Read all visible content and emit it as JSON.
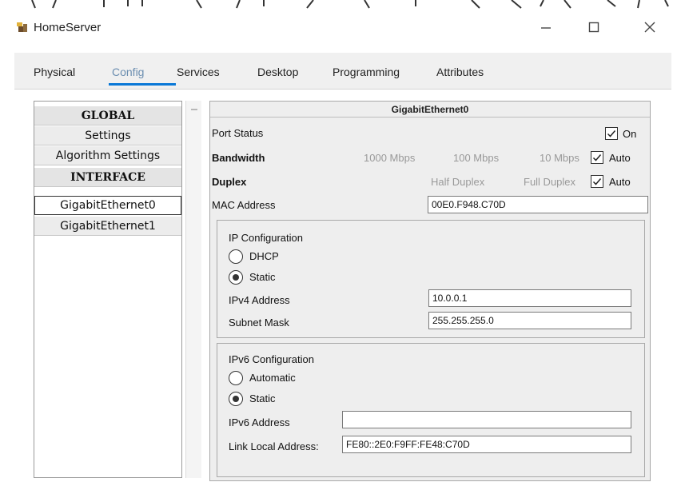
{
  "window": {
    "title": "HomeServer"
  },
  "tabs": [
    {
      "label": "Physical"
    },
    {
      "label": "Config"
    },
    {
      "label": "Services"
    },
    {
      "label": "Desktop"
    },
    {
      "label": "Programming"
    },
    {
      "label": "Attributes"
    }
  ],
  "active_tab": "Config",
  "sidebar": {
    "items": [
      {
        "label": "GLOBAL",
        "kind": "header"
      },
      {
        "label": "Settings",
        "kind": "item"
      },
      {
        "label": "Algorithm Settings",
        "kind": "item"
      },
      {
        "label": "INTERFACE",
        "kind": "header"
      },
      {
        "label": "GigabitEthernet0",
        "kind": "item",
        "selected": true
      },
      {
        "label": "GigabitEthernet1",
        "kind": "item"
      }
    ]
  },
  "interface": {
    "title": "GigabitEthernet0",
    "port_status": {
      "label": "Port Status",
      "on_label": "On",
      "checked": true
    },
    "bandwidth": {
      "label": "Bandwidth",
      "opt1": "1000 Mbps",
      "opt2": "100 Mbps",
      "opt3": "10 Mbps",
      "auto_label": "Auto",
      "auto_checked": true
    },
    "duplex": {
      "label": "Duplex",
      "opt1": "Half Duplex",
      "opt2": "Full Duplex",
      "auto_label": "Auto",
      "auto_checked": true
    },
    "mac": {
      "label": "MAC Address",
      "value": "00E0.F948.C70D"
    },
    "ipv4": {
      "title": "IP Configuration",
      "dhcp_label": "DHCP",
      "static_label": "Static",
      "mode": "static",
      "address_label": "IPv4 Address",
      "address_value": "10.0.0.1",
      "mask_label": "Subnet Mask",
      "mask_value": "255.255.255.0"
    },
    "ipv6": {
      "title": "IPv6 Configuration",
      "auto_label": "Automatic",
      "static_label": "Static",
      "mode": "static",
      "address_label": "IPv6 Address",
      "address_value": "",
      "link_local_label": "Link Local Address:",
      "link_local_value": "FE80::2E0:F9FF:FE48:C70D"
    }
  },
  "colors": {
    "accent_underline": "#0a78d7",
    "active_tab_text": "#6a8db0",
    "panel_bg": "#eeeeee"
  },
  "icons": {
    "app": "packet-tracer-server-icon",
    "minimize": "minimize-icon",
    "maximize": "maximize-icon",
    "close": "close-icon"
  }
}
